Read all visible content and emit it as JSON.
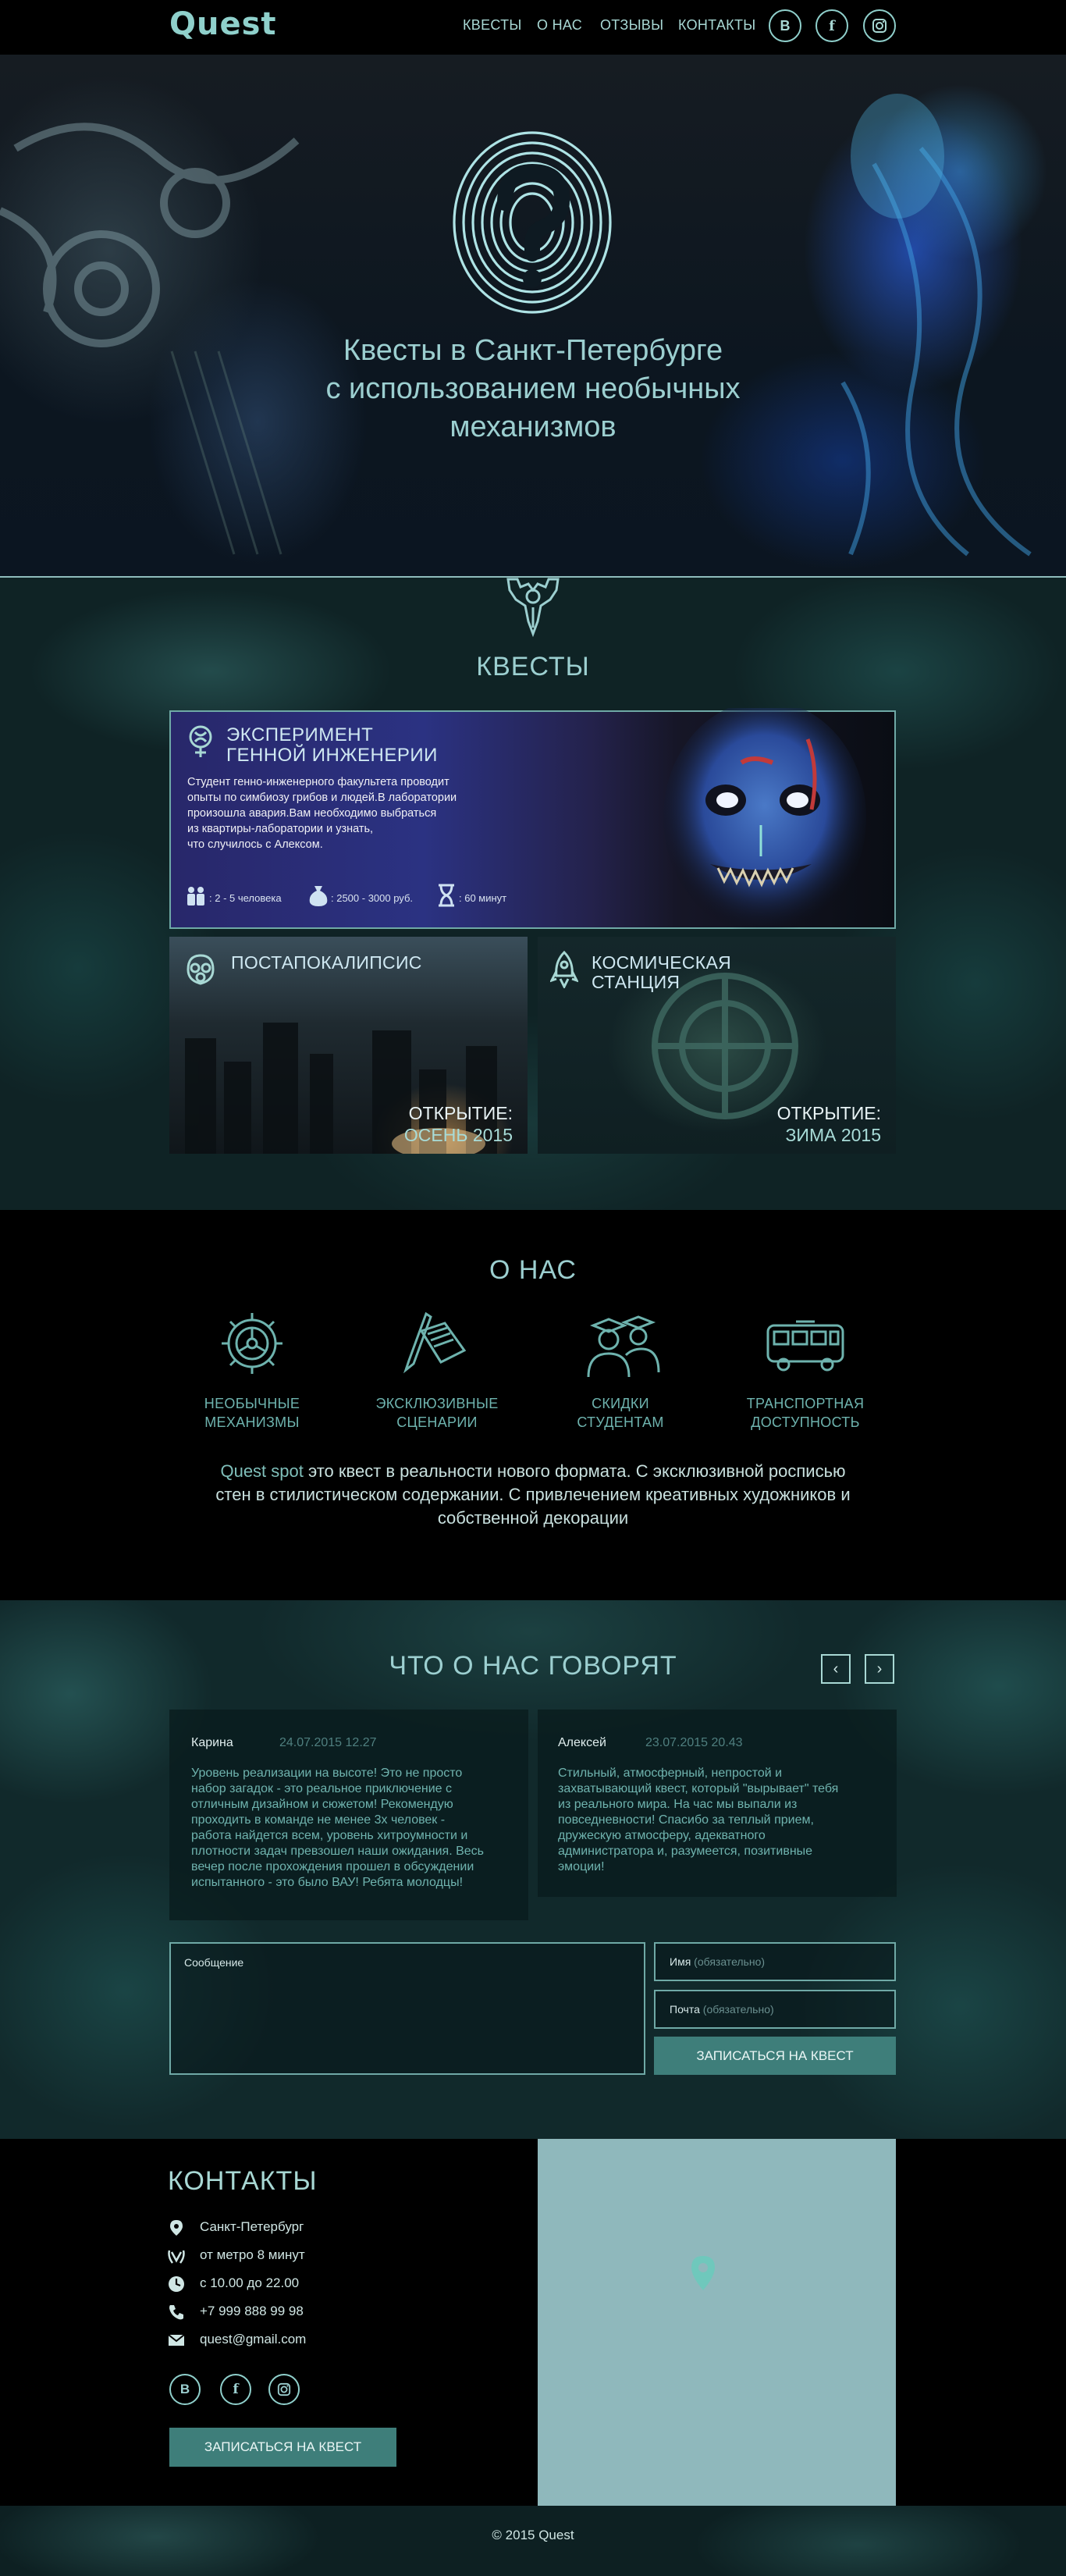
{
  "header": {
    "logo": "Quest",
    "nav": [
      "КВЕСТЫ",
      "О НАС",
      "ОТЗЫВЫ",
      "КОНТАКТЫ"
    ],
    "social": [
      "В",
      "f",
      "◎"
    ]
  },
  "hero": {
    "lines": [
      "Квесты в Санкт-Петербурге",
      "с использованием необычных",
      "механизмов"
    ]
  },
  "quests": {
    "title": "КВЕСТЫ",
    "main": {
      "title1": "ЭКСПЕРИМЕНТ",
      "title2": "ГЕННОЙ ИНЖЕНЕРИИ",
      "text": [
        "Студент генно-инженерного факультета проводит",
        "опыты по симбиозу грибов и людей.В лаборатории",
        "произошла авария.Вам необходимо выбраться",
        "из квартиры-лаборатории и узнать,",
        "что случилось с Алексом."
      ],
      "people": ": 2 - 5 человека",
      "price": ": 2500 - 3000 руб.",
      "time": ": 60 минут"
    },
    "cards": [
      {
        "title": [
          "ПОСТАПОКАЛИПСИС"
        ],
        "opening": "ОТКРЫТИЕ:",
        "season": "ОСЕНЬ 2015"
      },
      {
        "title": [
          "КОСМИЧЕСКАЯ",
          "СТАНЦИЯ"
        ],
        "opening": "ОТКРЫТИЕ:",
        "season": "ЗИМА 2015"
      }
    ]
  },
  "about": {
    "title": "О НАС",
    "features": [
      {
        "icon": "gear-icon",
        "lines": [
          "НЕОБЫЧНЫЕ",
          "МЕХАНИЗМЫ"
        ]
      },
      {
        "icon": "book-pen-icon",
        "lines": [
          "ЭКСКЛЮЗИВНЫЕ",
          "СЦЕНАРИИ"
        ]
      },
      {
        "icon": "students-icon",
        "lines": [
          "СКИДКИ",
          "СТУДЕНТАМ"
        ]
      },
      {
        "icon": "bus-icon",
        "lines": [
          "ТРАНСПОРТНАЯ",
          "ДОСТУПНОСТЬ"
        ]
      }
    ],
    "brand": "Quest spot",
    "text_rest": " это квест в реальности нового формата. С эксклюзивной росписью стен в стилистическом содержании. С привлечением креативных художников и собственной декорации"
  },
  "reviews": {
    "title": "ЧТО О НАС ГОВОРЯТ",
    "prev": "‹",
    "next": "›",
    "items": [
      {
        "name": "Карина",
        "date": "24.07.2015  12.27",
        "text": [
          "Уровень реализации на высоте! Это не просто",
          "набор загадок - это реальное приключение с",
          "отличным дизайном и сюжетом! Рекомендую",
          "проходить в команде не менее 3х человек -",
          "работа найдется всем, уровень хитроумности и",
          "плотности задач превзошел наши ожидания. Весь",
          "вечер после прохождения прошел в обсуждении",
          "испытанного - это было ВАУ! Ребята молодцы!"
        ]
      },
      {
        "name": "Алексей",
        "date": "23.07.2015  20.43",
        "text": [
          "Стильный, атмосферный, непростой и",
          "захватывающий квест, который \"вырывает\" тебя",
          "из реального мира. На час мы выпали из",
          "повседневности! Спасибо за теплый прием,",
          "дружескую атмосферу, адекватного",
          "администратора и, разумеется, позитивные",
          "эмоции!"
        ]
      }
    ],
    "form": {
      "message_label": "Сообщение",
      "name_label": "Имя",
      "name_hint": "(обязательно)",
      "email_label": "Почта",
      "email_hint": "(обязательно)",
      "submit": "ЗАПИСАТЬСЯ НА КВЕСТ"
    }
  },
  "contacts": {
    "title": "КОНТАКТЫ",
    "rows": [
      {
        "icon": "location-pin-icon",
        "text": "Санкт-Петербург"
      },
      {
        "icon": "metro-icon",
        "text": "от метро 8 минут"
      },
      {
        "icon": "clock-icon",
        "text": "с 10.00 до 22.00"
      },
      {
        "icon": "phone-icon",
        "text": "+7 999 888 99 98"
      },
      {
        "icon": "mail-icon",
        "text": "quest@gmail.com"
      }
    ],
    "social": [
      "В",
      "f",
      "◎"
    ],
    "button": "ЗАПИСАТЬСЯ НА КВЕСТ"
  },
  "footer": {
    "copyright": "© 2015 Quest"
  },
  "colors": {
    "accent": "#8fcfcb",
    "button": "#3e7e7a",
    "map": "#8fb8bc"
  }
}
